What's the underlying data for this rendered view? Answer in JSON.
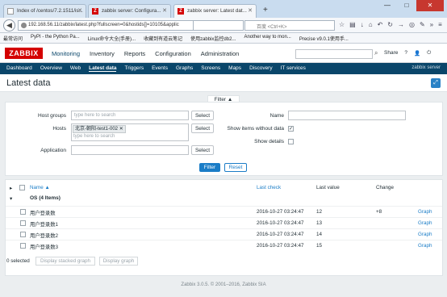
{
  "browser": {
    "tabs": [
      {
        "title": "Index of /centos/7.2.1511/is...",
        "active": false
      },
      {
        "title": "zabbix server: Configura...",
        "active": false
      },
      {
        "title": "zabbix server: Latest dat...",
        "active": true
      }
    ],
    "new_tab": "+",
    "url": "192.168.56.11/zabbix/latest.php?fullscreen=0&hostids[]=10105&applic",
    "search_placeholder": "百度 <Ctrl+K>",
    "bookmarks": [
      "最常访问",
      "PyPI - the Python Pa...",
      "Linux命令大全(手册)...",
      "收藏到有道云笔记",
      "使用zabbix监控db2...",
      "Another way to mon...",
      "Precise v9.0.1使用手..."
    ]
  },
  "zabbix": {
    "logo": "ZABBIX",
    "menu": [
      "Monitoring",
      "Inventory",
      "Reports",
      "Configuration",
      "Administration"
    ],
    "header_right": [
      "Share",
      "?"
    ],
    "submenu": [
      "Dashboard",
      "Overview",
      "Web",
      "Latest data",
      "Triggers",
      "Events",
      "Graphs",
      "Screens",
      "Maps",
      "Discovery",
      "IT services"
    ],
    "submenu_brand": "zabbix server",
    "page_title": "Latest data"
  },
  "filter": {
    "tab_label": "Filter ▲",
    "host_groups_label": "Host groups",
    "host_groups_placeholder": "type here to search",
    "hosts_label": "Hosts",
    "host_tag": "北京-朝阳-test1-002",
    "hosts_placeholder": "type here to search",
    "application_label": "Application",
    "select_label": "Select",
    "name_label": "Name",
    "show_without_data_label": "Show items without data",
    "show_without_data_checked": "✓",
    "show_details_label": "Show details",
    "filter_button": "Filter",
    "reset_button": "Reset"
  },
  "table": {
    "columns": {
      "name": "Name ▲",
      "last_check": "Last check",
      "last_value": "Last value",
      "change": "Change"
    },
    "group": "OS (4 Items)",
    "rows": [
      {
        "name": "用户登录数",
        "last_check": "2016-10-27 03:24:47",
        "last_value": "12",
        "change": "+8",
        "action": "Graph"
      },
      {
        "name": "用户登录数1",
        "last_check": "2016-10-27 03:24:47",
        "last_value": "13",
        "change": "",
        "action": "Graph"
      },
      {
        "name": "用户登录数2",
        "last_check": "2016-10-27 03:24:47",
        "last_value": "14",
        "change": "",
        "action": "Graph"
      },
      {
        "name": "用户登录数3",
        "last_check": "2016-10-27 03:24:47",
        "last_value": "15",
        "change": "",
        "action": "Graph"
      }
    ],
    "selected_count": "0 selected",
    "display_stacked": "Display stacked graph",
    "display_graph": "Display graph"
  },
  "footer": "Zabbix 3.0.5. © 2001–2016, Zabbix SIA"
}
